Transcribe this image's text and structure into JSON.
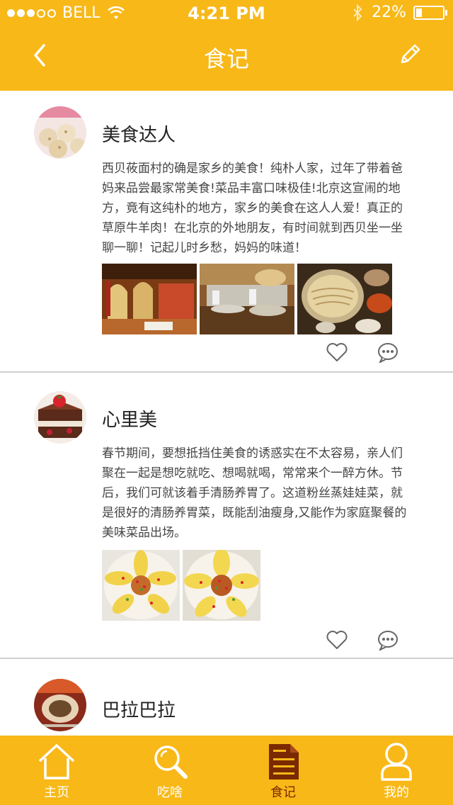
{
  "status_bar": {
    "carrier": "BELL",
    "time": "4:21 PM",
    "battery": "22%",
    "signal_dots_filled": 3,
    "signal_dots_total": 5
  },
  "nav": {
    "title": "食记",
    "back_icon": "chevron-left-icon",
    "edit_icon": "pencil-icon"
  },
  "posts": [
    {
      "user": "美食达人",
      "text": "西贝莜面村的确是家乡的美食！纯朴人家，过年了带着爸妈来品尝最家常美食!菜品丰富口味极佳!北京这宣闹的地方，竟有这纯朴的地方，家乡的美食在这人人爱！真正的草原牛羊肉！在北京的外地朋友，有时间就到西贝坐一坐聊一聊！记起儿时乡愁，妈妈的味道！",
      "images": [
        "restaurant-interior",
        "restaurant-kitchen",
        "noodle-dishes"
      ]
    },
    {
      "user": "心里美",
      "text": "春节期间，要想抵挡住美食的诱惑实在不太容易，亲人们聚在一起是想吃就吃、想喝就喝，常常来个一醉方休。节后，我们可就该着手清肠养胃了。这道粉丝蒸娃娃菜，就是很好的清肠养胃菜，既能刮油瘦身,又能作为家庭聚餐的美味菜品出场。",
      "images": [
        "steamed-cabbage-dish",
        "steamed-cabbage-dish"
      ]
    },
    {
      "user": "巴拉巴拉"
    }
  ],
  "tabs": [
    {
      "label": "主页",
      "icon": "home-icon"
    },
    {
      "label": "吃啥",
      "icon": "search-icon"
    },
    {
      "label": "食记",
      "icon": "document-icon",
      "active": true
    },
    {
      "label": "我的",
      "icon": "user-icon"
    }
  ],
  "colors": {
    "accent": "#f8b818",
    "active_tab": "#7a2a00",
    "text": "#444444"
  }
}
